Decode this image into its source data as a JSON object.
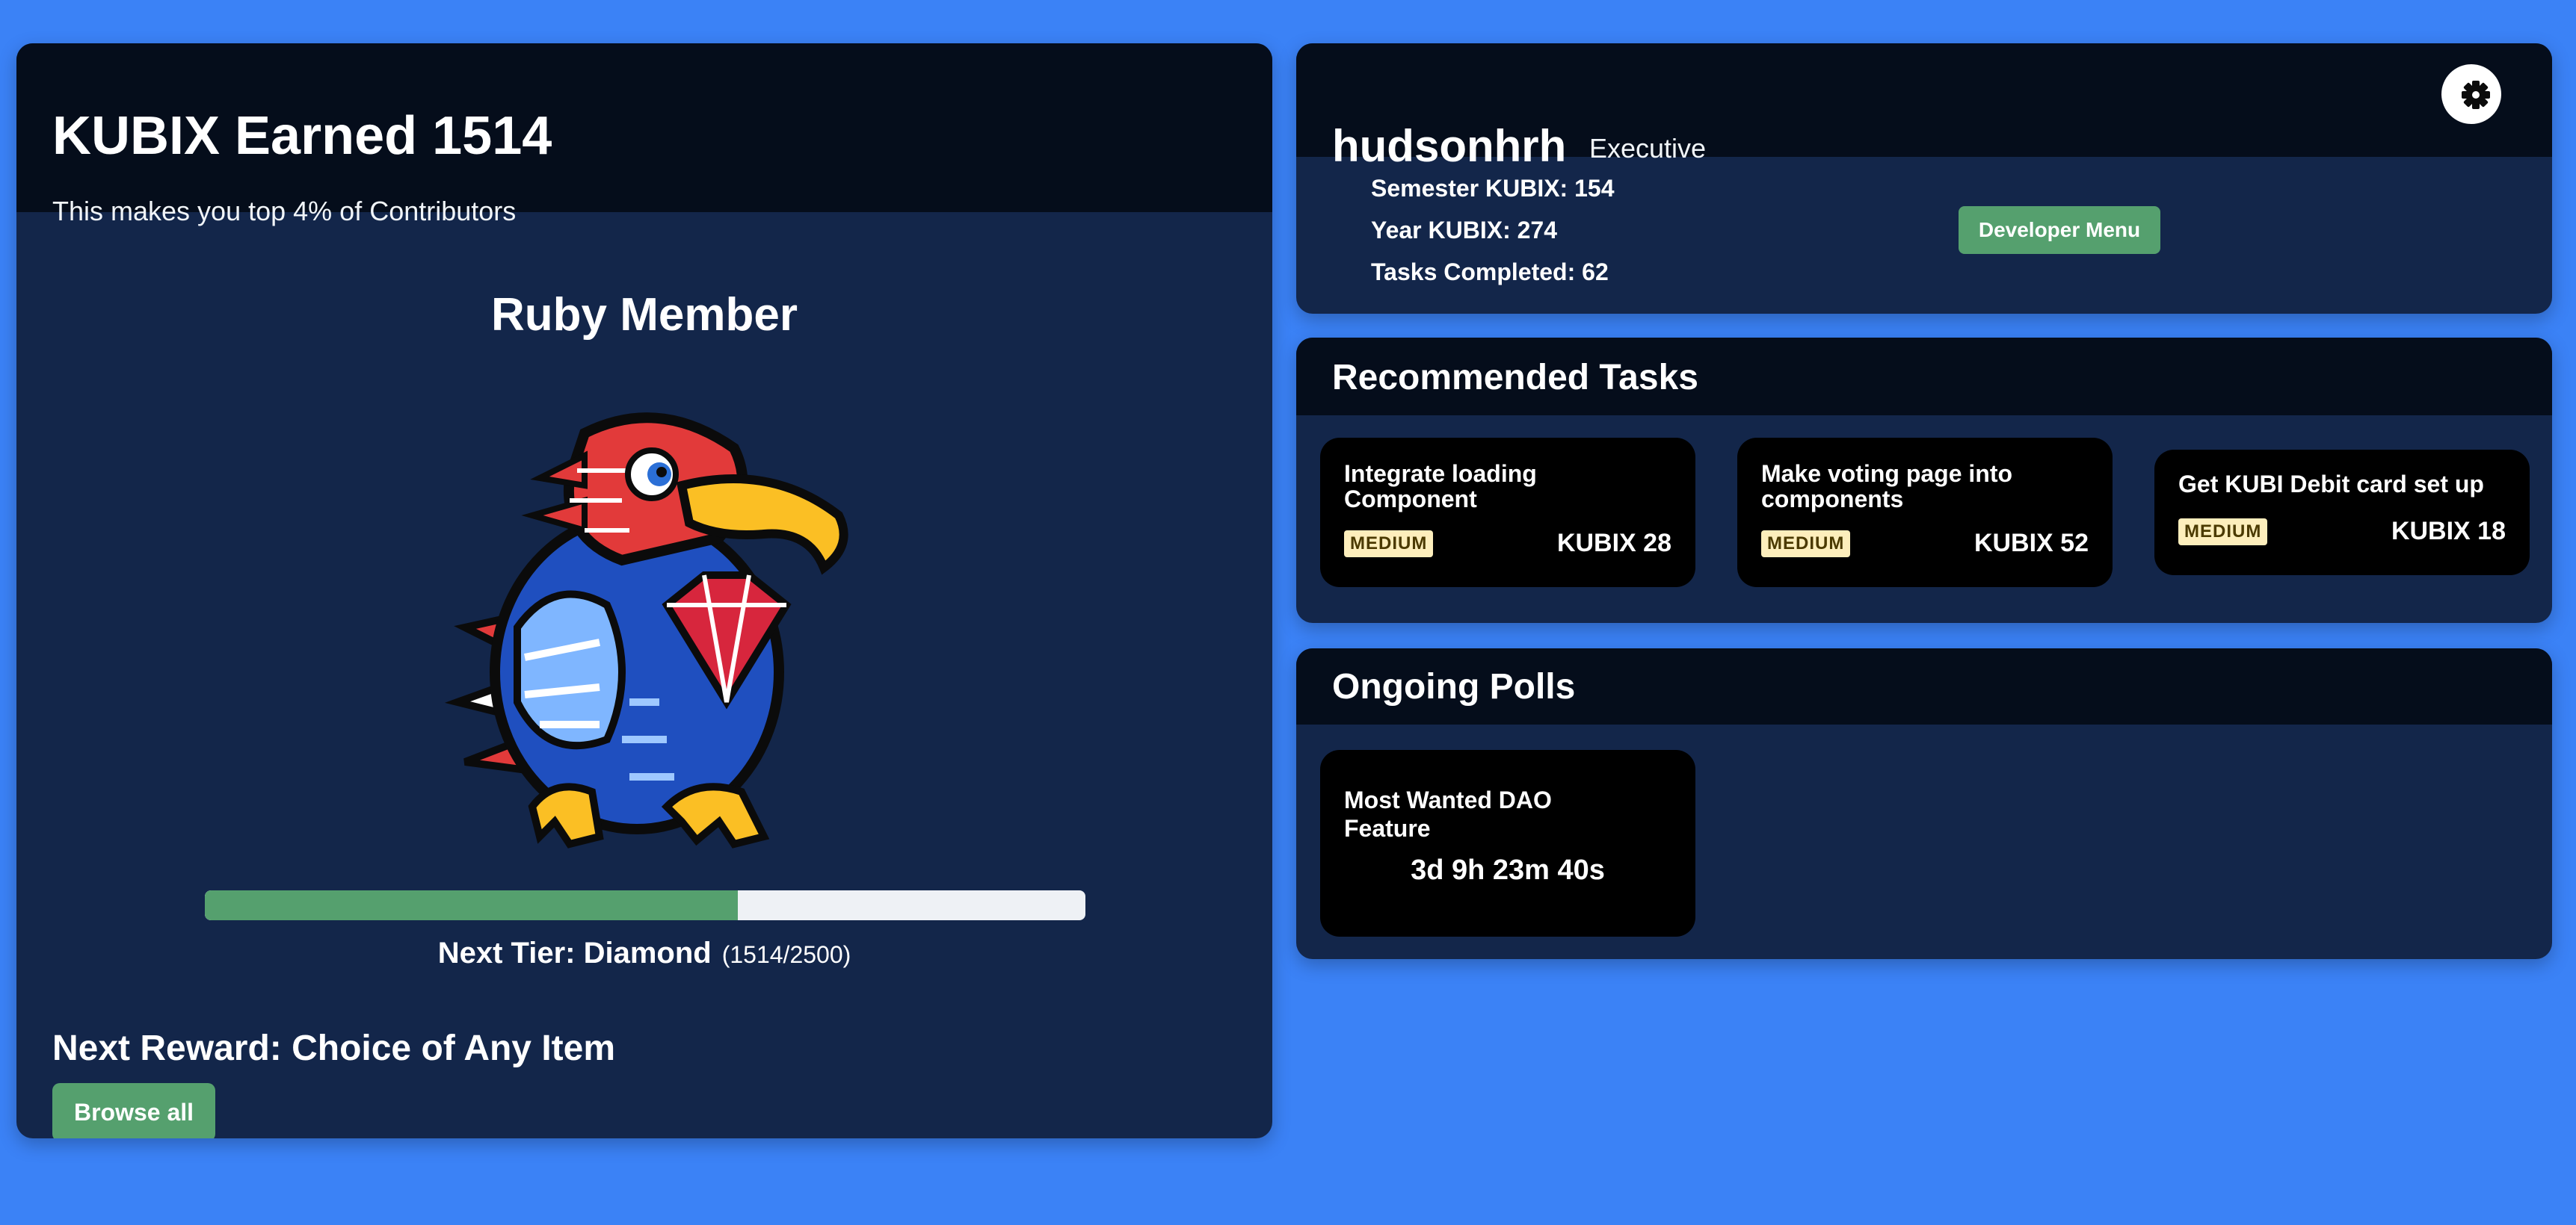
{
  "summary": {
    "kubix_earned_title": "KUBIX Earned 1514",
    "top_percent_text": "This makes you top 4% of Contributors",
    "tier_title": "Ruby Member",
    "next_tier_label": "Next Tier: Diamond",
    "next_tier_count": "(1514/2500)",
    "progress_fraction": 0.6056,
    "next_reward": "Next Reward: Choice of Any Item",
    "browse_label": "Browse all"
  },
  "profile": {
    "username": "hudsonhrh",
    "role": "Executive",
    "semester_kubix": "Semester KUBIX: 154",
    "year_kubix": "Year KUBIX: 274",
    "tasks_completed": "Tasks Completed: 62",
    "developer_menu_label": "Developer Menu",
    "settings_icon": "gear-icon"
  },
  "recommended": {
    "title": "Recommended Tasks",
    "tasks": [
      {
        "name": "Integrate loading Component",
        "difficulty": "MEDIUM",
        "kubix": "KUBIX 28"
      },
      {
        "name": "Make voting page into components",
        "difficulty": "MEDIUM",
        "kubix": "KUBIX 52"
      },
      {
        "name": "Get KUBI Debit card set up",
        "difficulty": "MEDIUM",
        "kubix": "KUBIX 18"
      }
    ]
  },
  "polls": {
    "title": "Ongoing Polls",
    "items": [
      {
        "name": "Most Wanted DAO Feature",
        "time_left": "3d 9h 23m 40s"
      }
    ]
  },
  "colors": {
    "page_bg": "#3b82f6",
    "card_bg": "#13264a",
    "header_bg": "#050d1b",
    "accent_green": "#55a06e",
    "badge_bg": "#fdeebc"
  }
}
